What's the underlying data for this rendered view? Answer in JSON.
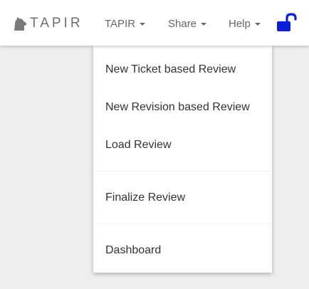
{
  "brand": {
    "name": "TAPIR",
    "logo_icon": "tapir-logo-icon"
  },
  "nav": {
    "tapir_label": "TAPIR",
    "share_label": "Share",
    "help_label": "Help"
  },
  "lock": {
    "icon": "unlocked-padlock-icon",
    "color": "#0a1fd6"
  },
  "dropdown": {
    "items": [
      {
        "label": "New Ticket based Review"
      },
      {
        "label": "New Revision based Review"
      },
      {
        "label": "Load Review"
      },
      {
        "label": "Finalize Review"
      },
      {
        "label": "Dashboard"
      }
    ]
  }
}
